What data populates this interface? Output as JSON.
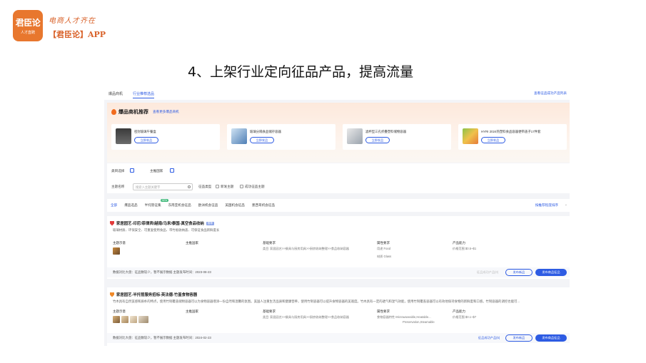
{
  "brand": {
    "logo_text": "君臣论",
    "logo_sub": "人才直聘",
    "slogan": "电商人才齐在",
    "app_name": "【君臣论】APP",
    "accent": "#e8772e"
  },
  "slide": {
    "title": "4、上架行业定向征品产品，提高流量"
  },
  "screen": {
    "tabs": [
      "爆品商机",
      "行业推荐选品"
    ],
    "tab_right_link": "查看征品成功产品列表",
    "recommend": {
      "title": "爆品商机推荐",
      "link": "查看更多爆品商机",
      "cards": [
        {
          "text": "密封玻璃午餐盒",
          "button": "立即发品"
        },
        {
          "text": "玻璃分隔食品储存容器",
          "button": "立即发品"
        },
        {
          "text": "滤杯型三孔折叠塑料储物容器",
          "button": "立即发品"
        },
        {
          "text": "HYRI 2024热塑料食品容器便带盖子17件套",
          "button": "立即发品"
        }
      ]
    },
    "filters": {
      "product_select_label": "类目选择",
      "theme_select_label": "主推国家",
      "search_label": "主题名称",
      "search_placeholder": "搜索入主题关键字",
      "status_label": "征品类型",
      "checkbox_1": "新发主题",
      "checkbox_2": "成功征品主题"
    },
    "categories": [
      "全部",
      "爆品选品",
      "半托管征集",
      "东南亚机会征品",
      "欧洲机会征品",
      "美国机会征品",
      "墨西哥机会征品"
    ],
    "category_new_badge": "NEW",
    "category_right_link": "按推荐程度排序",
    "items": [
      {
        "name": "家居园艺-印尼/菲律宾/越南/马来/泰国-真空食品收纳",
        "tag": "推荐",
        "desc": "玻璃材质、环保安全、可重复使用食品、带竹板收纳盖、可保证食品新鲜度长",
        "col_headers": [
          "主题示意",
          "主推国家",
          "基础要求",
          "属性要求",
          "产品能力"
        ],
        "category_path": "家居园艺>>餐具与厨房用具>>厨房收纳整理>>食品收纳容器",
        "category_prefix": "类目",
        "attr_1": "用途  Food",
        "attr_2": "材质  Glass",
        "price": "价格范围  $0.5~$1",
        "footer": "数据对比大盘：征品数较少，暂不展示数据    主题发布时间：2023-08-23",
        "footer_link": "征品成功产品(0)",
        "btn_outline": "发布新品",
        "btn_fill": "发布商品征品"
      },
      {
        "name": "家居园艺-半托管服务招标-英法德-竹盖食物容器",
        "tag": "",
        "desc": "竹木具有自然美感和质朴的特点，使用竹制覆盖储物容器可以为食物容器增添一份自然和温馨的氛围。美国人注重生活品质和健康营养，使用竹制容器可以提升食物容器的美观度。竹木具有一定的透气和湿气效能，使用竹制覆盖容器可以有效地保持食物的新鲜度和口感。竹制容器的调控也能可...",
        "col_headers": [
          "主题示意",
          "主推国家",
          "基础要求",
          "属性要求",
          "产品能力"
        ],
        "category_path": "家居园艺>>餐具与厨房用具>>厨房收纳整理>>食品收纳容器",
        "category_prefix": "类目",
        "attr_1": "食物容器特性  Microwaveable,Heatable...",
        "attr_2": "Preservation,Steamable",
        "price": "价格范围  $0.1~$7",
        "footer": "数据对比大盘：征品数较少，暂不展示数据    主题发布时间：2024-02-23",
        "footer_link": "征品成功产品(5)",
        "btn_outline": "发布新品",
        "btn_fill": "发布商品征品"
      }
    ]
  }
}
